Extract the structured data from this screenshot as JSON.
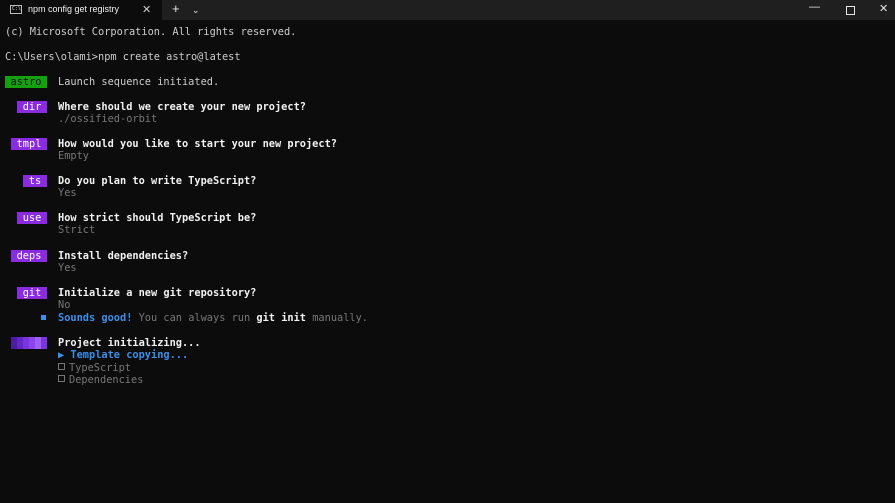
{
  "window": {
    "tab_title": "npm config get registry",
    "tab_close": "✕",
    "tab_icon_text": "C:\\",
    "new_tab": "+",
    "tab_dropdown": "⌄",
    "minimize": "—",
    "close": "✕"
  },
  "terminal": {
    "copyright": "(c) Microsoft Corporation. All rights reserved.",
    "command": "C:\\Users\\olami>npm create astro@latest",
    "launch": {
      "badge": "astro",
      "text": "Launch sequence initiated."
    },
    "steps": [
      {
        "badge": "dir",
        "question": "Where should we create your new project?",
        "answer": "./ossified-orbit"
      },
      {
        "badge": "tmpl",
        "question": "How would you like to start your new project?",
        "answer": "Empty"
      },
      {
        "badge": "ts",
        "question": "Do you plan to write TypeScript?",
        "answer": "Yes"
      },
      {
        "badge": "use",
        "question": "How strict should TypeScript be?",
        "answer": "Strict"
      },
      {
        "badge": "deps",
        "question": "Install dependencies?",
        "answer": "Yes"
      },
      {
        "badge": "git",
        "question": "Initialize a new git repository?",
        "answer": "No"
      }
    ],
    "note": {
      "highlight": "Sounds good!",
      "text_before": " You can always run ",
      "command": "git init",
      "text_after": " manually."
    },
    "init": {
      "title": "Project initializing...",
      "active_task": "▶ Template copying...",
      "pending_tasks": [
        "TypeScript",
        "Dependencies"
      ]
    }
  },
  "colors": {
    "background": "#0c0c0c",
    "badge_purple": "#8a2be2",
    "badge_green": "#13a10e",
    "accent_blue": "#3b8eea"
  }
}
